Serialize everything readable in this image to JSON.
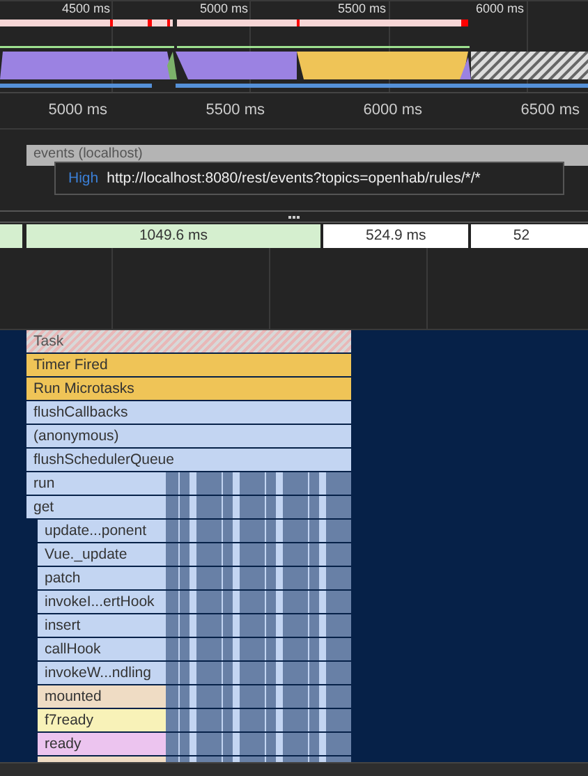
{
  "overview": {
    "ticks": [
      "4500 ms",
      "5000 ms",
      "5500 ms",
      "6000 ms"
    ]
  },
  "ruler": {
    "ticks": [
      "5000 ms",
      "5500 ms",
      "6000 ms",
      "6500 ms"
    ]
  },
  "network": {
    "request": "events (localhost)",
    "tooltip": {
      "priority": "High",
      "url": "http://localhost:8080/rest/events?topics=openhab/rules/*/*"
    }
  },
  "frames": [
    {
      "label": "1049.6 ms",
      "kind": "long"
    },
    {
      "label": "524.9 ms",
      "kind": "normal"
    },
    {
      "label": "52",
      "kind": "normal"
    }
  ],
  "flame": [
    {
      "label": "Task",
      "kind": "task",
      "color": "#e8b8b8",
      "nested": false
    },
    {
      "label": "Timer Fired",
      "kind": "outer",
      "color": "#efc457",
      "nested": false
    },
    {
      "label": "Run Microtasks",
      "kind": "outer",
      "color": "#efc457",
      "nested": false
    },
    {
      "label": "flushCallbacks",
      "kind": "outer",
      "color": "#c3d5f2",
      "nested": false
    },
    {
      "label": "(anonymous)",
      "kind": "outer",
      "color": "#c3d5f2",
      "nested": false
    },
    {
      "label": "flushSchedulerQueue",
      "kind": "outer",
      "color": "#c3d5f2",
      "nested": false
    },
    {
      "label": "run",
      "kind": "outer",
      "color": "#c3d5f2",
      "nested": true
    },
    {
      "label": "get",
      "kind": "outer",
      "color": "#c3d5f2",
      "nested": true
    },
    {
      "label": "update...ponent",
      "kind": "inner",
      "color": "#c3d5f2",
      "nested": true
    },
    {
      "label": "Vue._update",
      "kind": "inner",
      "color": "#c3d5f2",
      "nested": true
    },
    {
      "label": "patch",
      "kind": "inner",
      "color": "#c3d5f2",
      "nested": true
    },
    {
      "label": "invokeI...ertHook",
      "kind": "inner",
      "color": "#c3d5f2",
      "nested": true
    },
    {
      "label": "insert",
      "kind": "inner",
      "color": "#c3d5f2",
      "nested": true
    },
    {
      "label": "callHook",
      "kind": "inner",
      "color": "#c3d5f2",
      "nested": true
    },
    {
      "label": "invokeW...ndling",
      "kind": "inner",
      "color": "#c3d5f2",
      "nested": true
    },
    {
      "label": "mounted",
      "kind": "inner",
      "color": "#efdcc4",
      "nested": true
    },
    {
      "label": "f7ready",
      "kind": "inner",
      "color": "#f8f2b8",
      "nested": true
    },
    {
      "label": "ready",
      "kind": "inner",
      "color": "#ecc4ef",
      "nested": true
    }
  ]
}
